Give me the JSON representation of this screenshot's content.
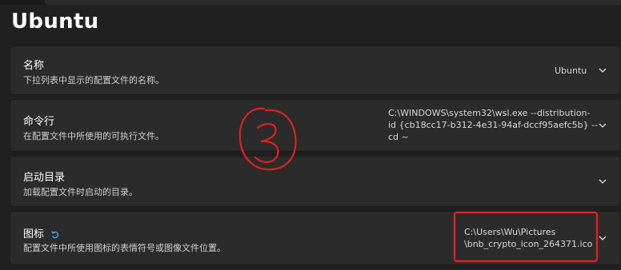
{
  "window": {
    "title": "Ubuntu"
  },
  "settings": [
    {
      "id": "name",
      "label": "名称",
      "description": "下拉列表中显示的配置文件的名称。",
      "value": "Ubuntu"
    },
    {
      "id": "command-line",
      "label": "命令行",
      "description": "在配置文件中所使用的可执行文件。",
      "value_lines": [
        "C:\\WINDOWS\\system32\\wsl.exe --distribution-",
        "id {cb18cc17-b312-4e31-94af-dccf95aefc5b} --",
        "cd ~"
      ]
    },
    {
      "id": "starting-directory",
      "label": "启动目录",
      "description": "加载配置文件时启动的目录。",
      "value": ""
    },
    {
      "id": "icon",
      "label": "图标",
      "description": "配置文件中所使用图标的表情符号或图像文件位置。",
      "value_lines": [
        "C:\\Users\\Wu\\Pictures",
        "\\bnb_crypto_icon_264371.ico"
      ]
    }
  ],
  "colors": {
    "background": "#202020",
    "card": "#2b2b2b",
    "annotation": "#e02020",
    "accent": "#4aa3ff"
  },
  "icons": {
    "chevron": "chevron-down-icon",
    "reset": "reset-icon"
  }
}
